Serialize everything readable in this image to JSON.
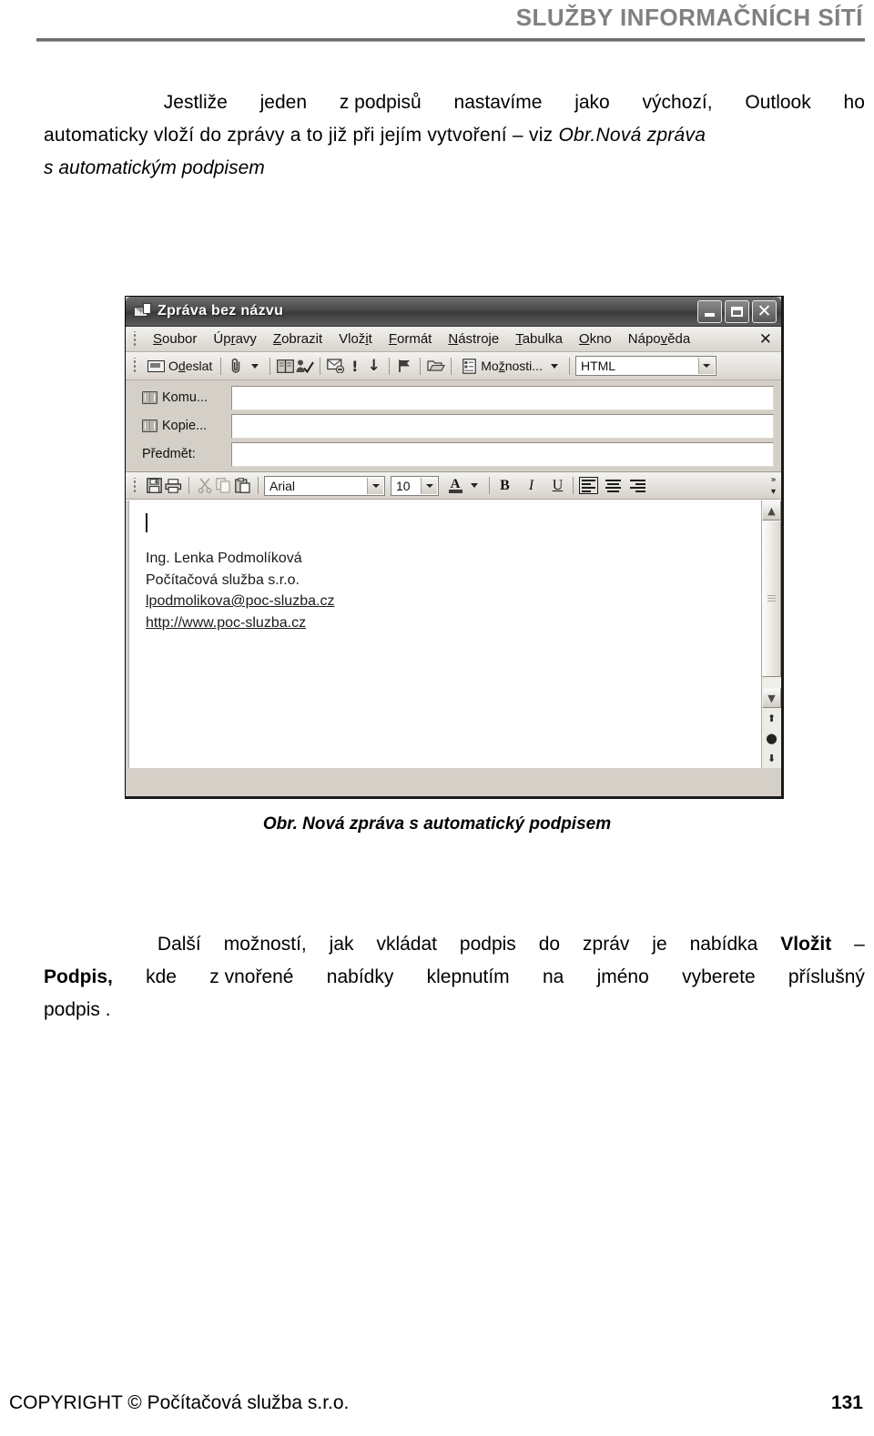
{
  "header": {
    "title": "SLUŽBY INFORMAČNÍCH SÍTÍ"
  },
  "intro_paragraph": {
    "line1_a": "Jestliže",
    "line1_b": "jeden",
    "line1_c": "z podpisů",
    "line1_d": "nastavíme",
    "line1_e": "jako",
    "line1_f": "výchozí,",
    "line1_g": "Outlook",
    "line1_h": "ho",
    "line2": "automaticky vloží do zprávy a to již při jejím vytvoření – viz ",
    "line2_italic": "Obr.Nová zpráva",
    "line3_italic": "s automatickým podpisem"
  },
  "figure": {
    "caption": "Obr. Nová zpráva s automatický podpisem"
  },
  "outlook_window": {
    "title": "Zpráva bez názvu",
    "title_icon": "message-icon",
    "window_buttons": {
      "minimize": "minimize-icon",
      "maximize": "maximize-icon",
      "close": "✕"
    },
    "menu": [
      {
        "pre": "",
        "acc": "S",
        "post": "oubor"
      },
      {
        "pre": "Úp",
        "acc": "r",
        "post": "avy"
      },
      {
        "pre": "",
        "acc": "Z",
        "post": "obrazit"
      },
      {
        "pre": "Vlož",
        "acc": "i",
        "post": "t"
      },
      {
        "pre": "",
        "acc": "F",
        "post": "ormát"
      },
      {
        "pre": "",
        "acc": "N",
        "post": "ástroje"
      },
      {
        "pre": "",
        "acc": "T",
        "post": "abulka"
      },
      {
        "pre": "",
        "acc": "O",
        "post": "kno"
      },
      {
        "pre": "Nápo",
        "acc": "v",
        "post": "ěda"
      }
    ],
    "menu_close_label": "✕",
    "standard_toolbar": {
      "send_pre": "O",
      "send_acc": "d",
      "send_post": "eslat",
      "attach_icon": "paperclip-icon",
      "address_book_icon": "address-book-icon",
      "check_names_icon": "check-names-icon",
      "signature_icon": "signature-envelope-icon",
      "high_importance_icon": "!",
      "low_importance_icon": "↓",
      "flag_icon": "flag-icon",
      "folder_icon": "move-to-folder-icon",
      "options_pre": "Mo",
      "options_acc": "ž",
      "options_post": "nosti...",
      "format_value": "HTML"
    },
    "address_fields": [
      {
        "label": "Komu...",
        "icon": "address-book-icon",
        "value": ""
      },
      {
        "label": "Kopie...",
        "icon": "address-book-icon",
        "value": ""
      }
    ],
    "subject_field": {
      "label": "Předmět:",
      "value": ""
    },
    "formatting_toolbar": {
      "save_icon": "save-icon",
      "print_icon": "print-icon",
      "cut_icon": "cut-icon",
      "copy_icon": "copy-icon",
      "paste_icon": "paste-icon",
      "font_name": "Arial",
      "font_size": "10",
      "font_color_icon": "font-color-icon",
      "bold_label": "B",
      "italic_label": "I",
      "underline_label": "U",
      "align_left_icon": "align-left-icon",
      "align_center_icon": "align-center-icon",
      "align_right_icon": "align-right-icon",
      "active_alignment": "left",
      "overflow_label": "»"
    },
    "message_body": {
      "cursor": "text-caret",
      "signature": [
        "Ing. Lenka Podmolíková",
        "Počítačová služba s.r.o.",
        "lpodmolikova@poc-sluzba.cz",
        "http://www.poc-sluzba.cz"
      ],
      "signature_link_start_index": 2
    },
    "scrollbar": {
      "up_arrow": "▲",
      "down_arrow": "▼",
      "prev_object": "⬆",
      "select_object": "⬤",
      "next_object": "⬇"
    }
  },
  "after_paragraph": {
    "l1_a": "Další",
    "l1_b": "možností,",
    "l1_c": "jak",
    "l1_d": "vkládat",
    "l1_e": "podpis",
    "l1_f": "do",
    "l1_g": "zpráv",
    "l1_h": "je",
    "l1_i": "nabídka",
    "l1_bold": "Vložit",
    "l1_dash": "–",
    "l2_bold": "Podpis,",
    "l2_a": "kde",
    "l2_b": "z vnořené",
    "l2_c": "nabídky",
    "l2_d": "klepnutím",
    "l2_e": "na",
    "l2_f": "jméno",
    "l2_g": "vyberete",
    "l2_h": "příslušný",
    "l3": "podpis ."
  },
  "footer": {
    "copyright": "COPYRIGHT ©  Počítačová služba s.r.o.",
    "page_number": "131"
  }
}
